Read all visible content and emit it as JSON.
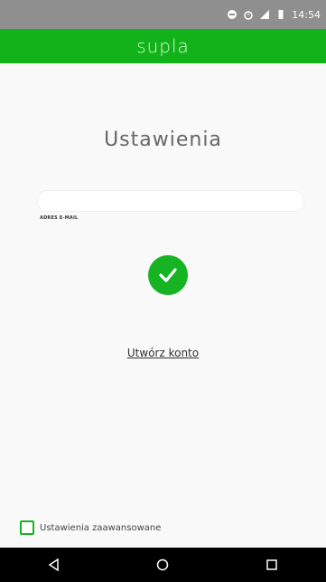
{
  "status_bar": {
    "time": "14:54",
    "icons": [
      "notification-dot-icon",
      "alarm-icon",
      "signal-icon",
      "battery-icon"
    ]
  },
  "app_bar": {
    "logo": "supla",
    "bg": "#12b31a"
  },
  "screen": {
    "title": "Ustawienia",
    "email_input": {
      "value": "",
      "placeholder": ""
    },
    "email_label": "ADRES E-MAIL",
    "status_icon": "check-circle-icon",
    "create_account_link": "Utwórz konto",
    "advanced_settings": {
      "label": "Ustawienia zaawansowane",
      "checked": false
    }
  },
  "navigation_bar": {
    "buttons": [
      "back-icon",
      "home-icon",
      "recents-icon"
    ]
  }
}
